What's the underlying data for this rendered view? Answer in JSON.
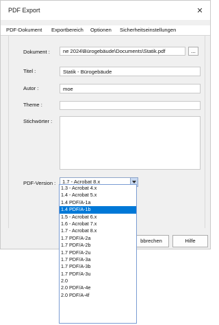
{
  "window": {
    "title": "PDF Export",
    "close_glyph": "✕"
  },
  "tabs": [
    {
      "label": "PDF-Dokument",
      "active": true
    },
    {
      "label": "Exportbereich",
      "active": false
    },
    {
      "label": "Optionen",
      "active": false
    },
    {
      "label": "Sicherheitseinstellungen",
      "active": false
    }
  ],
  "form": {
    "document_label": "Dokument :",
    "document_value": "ne 2024\\Bürogebäude\\Documents\\Statik.pdf",
    "browse_label": "...",
    "title_label": "Titel :",
    "title_value": "Statik - Bürogebäude",
    "author_label": "Autor :",
    "author_value": "moe",
    "theme_label": "Theme :",
    "theme_value": "",
    "keywords_label": "Stichwörter :",
    "keywords_value": "",
    "pdf_version_label": "PDF-Version :",
    "pdf_version_selected": "1.7 - Acrobat 8.x"
  },
  "pdf_version_options": [
    "1.3 - Acrobat 4.x",
    "1.4 - Acrobat 5.x",
    "1.4 PDF/A-1a",
    "1.4 PDF/A-1b",
    "1.5 - Acrobat 6.x",
    "1.6 - Acrobat 7.x",
    "1.7 - Acrobat 8.x",
    "1.7 PDF/A-2a",
    "1.7 PDF/A-2b",
    "1.7 PDF/A-2u",
    "1.7 PDF/A-3a",
    "1.7 PDF/A-3b",
    "1.7 PDF/A-3u",
    "2.0",
    "2.0 PDF/A-4e",
    "2.0 PDF/A-4f"
  ],
  "highlighted_option": "1.4 PDF/A-1b",
  "buttons": {
    "cancel": "bbrechen",
    "help": "Hilfe"
  },
  "colors": {
    "highlight": "#0078d7",
    "dialog_bg": "#f0f0f0"
  }
}
